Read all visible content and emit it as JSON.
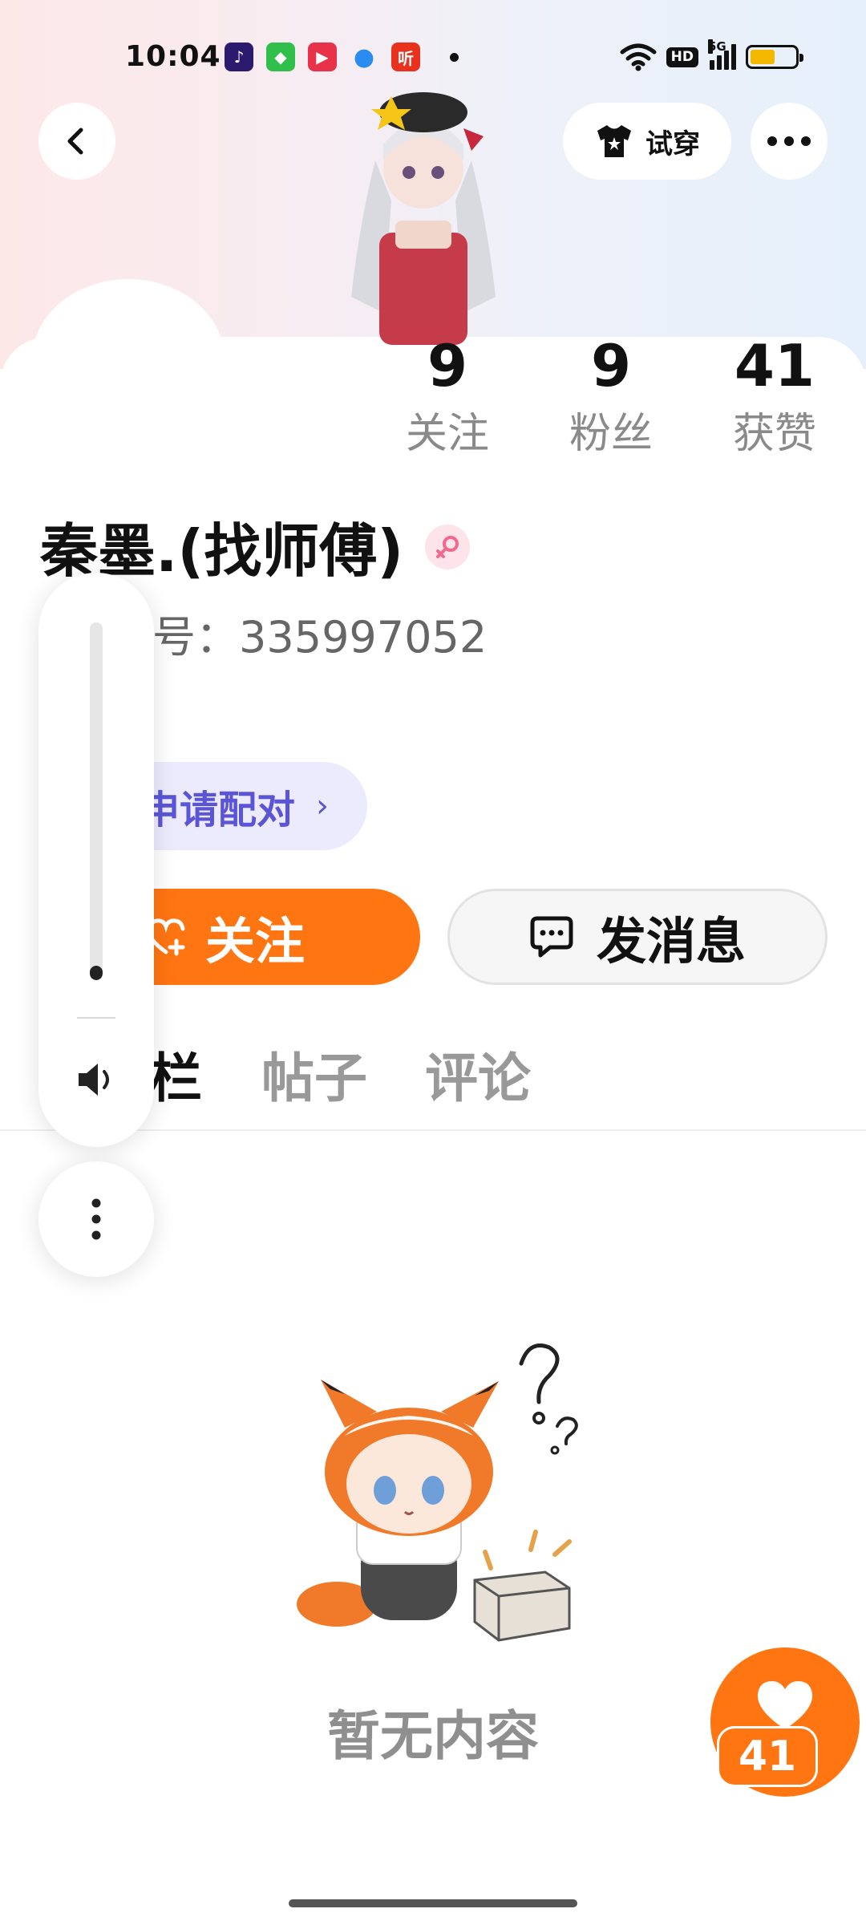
{
  "status_bar": {
    "time": "10:04",
    "network": "5G",
    "hd": "HD",
    "battery_level": 0.55,
    "apps": [
      {
        "icon": "tiktok-icon",
        "color": "#2b1a6e"
      },
      {
        "icon": "green-app-icon",
        "color": "#2fbf4a"
      },
      {
        "icon": "video-play-icon",
        "color": "#e8324a"
      },
      {
        "icon": "blue-feather-icon",
        "color": "#2a8cf0"
      },
      {
        "icon": "listen-app-icon",
        "color": "#e8321e",
        "label": "听"
      }
    ]
  },
  "header": {
    "back_icon": "chevron-left-icon",
    "tryon_label": "试穿",
    "tryon_icon": "shirt-icon",
    "more_icon": "more-dots-icon"
  },
  "stats": [
    {
      "value": "9",
      "label": "关注"
    },
    {
      "value": "9",
      "label": "粉丝"
    },
    {
      "value": "41",
      "label": "获赞"
    }
  ],
  "profile": {
    "name": "秦墨.(找师傅)",
    "gender_icon": "female-icon",
    "id_label": "号：",
    "id_value": "335997052",
    "pair_label": "申请配对",
    "pair_chevron": "›"
  },
  "actions": {
    "follow_label": "关注",
    "message_label": "发消息"
  },
  "tabs": {
    "active": "栏",
    "posts": "帖子",
    "comments": "评论"
  },
  "volume": {
    "level": 0.04,
    "icon": "speaker-icon",
    "more_icon": "vertical-dots-icon"
  },
  "empty_state": {
    "text": "暂无内容"
  },
  "like_fab": {
    "count": "41",
    "icon": "heart-icon"
  },
  "colors": {
    "accent": "#ff7512",
    "pair_text": "#5b55d6",
    "pair_bg": "#ecebfd"
  }
}
